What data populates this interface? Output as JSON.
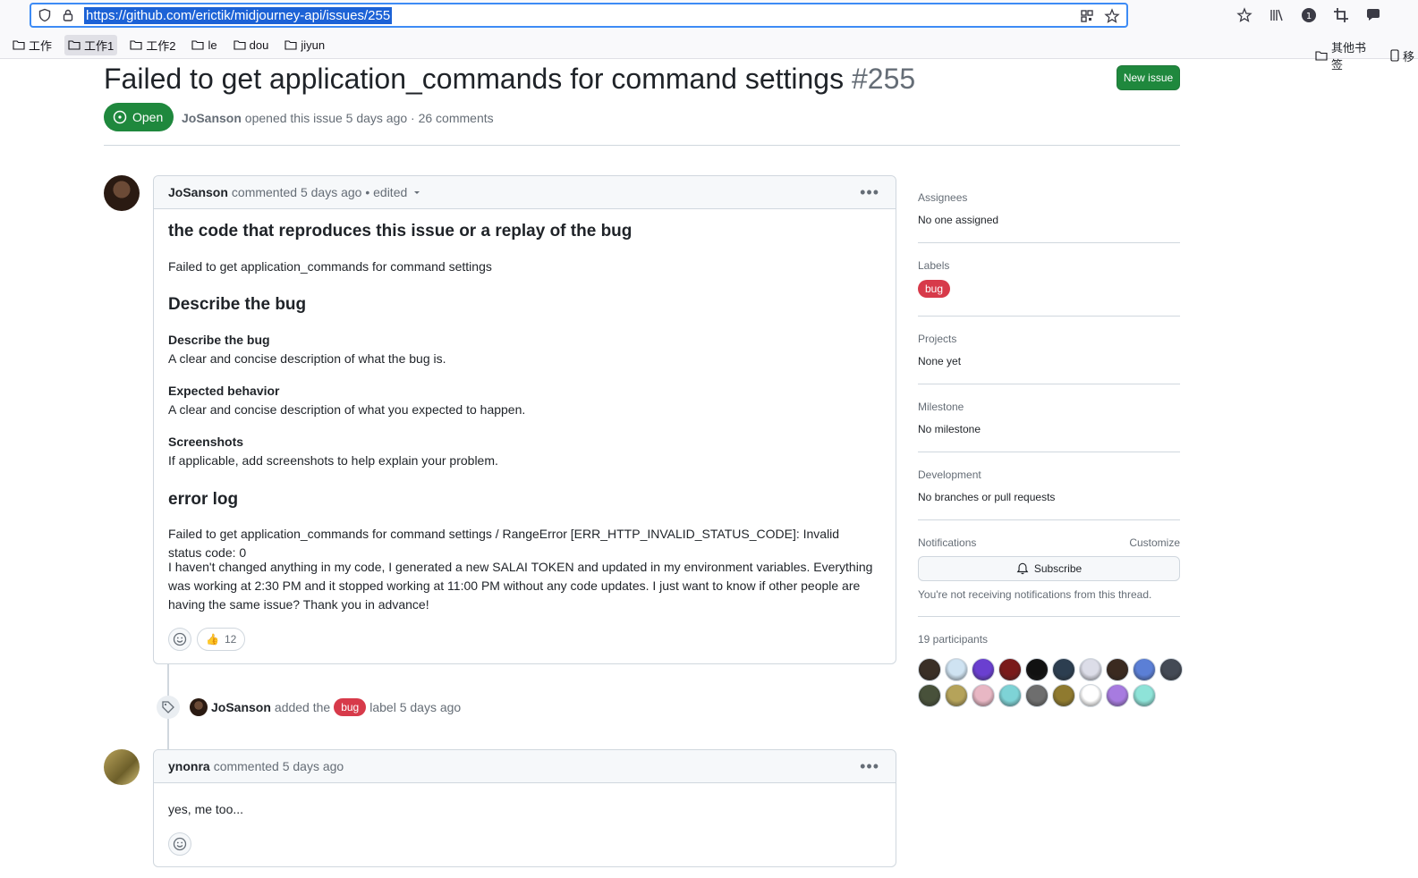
{
  "browser": {
    "url": "https://github.com/erictik/midjourney-api/issues/255",
    "bookmarks": [
      "工作",
      "工作1",
      "工作2",
      "le",
      "dou",
      "jiyun"
    ],
    "bookmarks_right": "其他书签",
    "bookmarks_cut": "移"
  },
  "issue": {
    "title": "Failed to get application_commands for command settings",
    "number": "#255",
    "new_issue_label": "New issue",
    "state": "Open",
    "author": "JoSanson",
    "meta_text": "opened this issue 5 days ago · 26 comments"
  },
  "comment1": {
    "author": "JoSanson",
    "meta": "commented 5 days ago • edited",
    "h_reproduce": "the code that reproduces this issue or a replay of the bug",
    "p_reproduce": "Failed to get application_commands for command settings",
    "h_describe": "Describe the bug",
    "describe_title": "Describe the bug",
    "describe_text": "A clear and concise description of what the bug is.",
    "expected_title": "Expected behavior",
    "expected_text": "A clear and concise description of what you expected to happen.",
    "screenshots_title": "Screenshots",
    "screenshots_text": "If applicable, add screenshots to help explain your problem.",
    "h_errorlog": "error log",
    "p_errorlog": "Failed to get application_commands for command settings / RangeError [ERR_HTTP_INVALID_STATUS_CODE]: Invalid status code: 0",
    "p_body": "I haven't changed anything in my code, I generated a new SALAI TOKEN and updated in my environment variables. Everything was working at 2:30 PM and it stopped working at 11:00 PM without any code updates. I just want to know if other people are having the same issue? Thank you in advance!",
    "reaction_emoji": "👍",
    "reaction_count": "12"
  },
  "event": {
    "actor": "JoSanson",
    "pre": "added the",
    "label": "bug",
    "post": "label 5 days ago"
  },
  "comment2": {
    "author": "ynonra",
    "meta": "commented 5 days ago",
    "body": "yes, me too..."
  },
  "sidebar": {
    "assignees_h": "Assignees",
    "assignees_v": "No one assigned",
    "labels_h": "Labels",
    "labels_v": "bug",
    "projects_h": "Projects",
    "projects_v": "None yet",
    "milestone_h": "Milestone",
    "milestone_v": "No milestone",
    "development_h": "Development",
    "development_v": "No branches or pull requests",
    "notifications_h": "Notifications",
    "customize": "Customize",
    "subscribe": "Subscribe",
    "notifications_note": "You're not receiving notifications from this thread.",
    "participants_h": "19 participants",
    "participant_colors": [
      "#3a2f26",
      "#cfe3f2",
      "#6a3fd0",
      "#7a1a1a",
      "#111111",
      "#2c3e50",
      "#dcdde8",
      "#3b2a20",
      "#5b7fd6",
      "#444a55",
      "#48513a",
      "#b5a35a",
      "#e8b7c4",
      "#7ed3d6",
      "#6e6e6e",
      "#8f7a2f",
      "#ffffff",
      "#a77be0",
      "#8ee3d8"
    ]
  }
}
